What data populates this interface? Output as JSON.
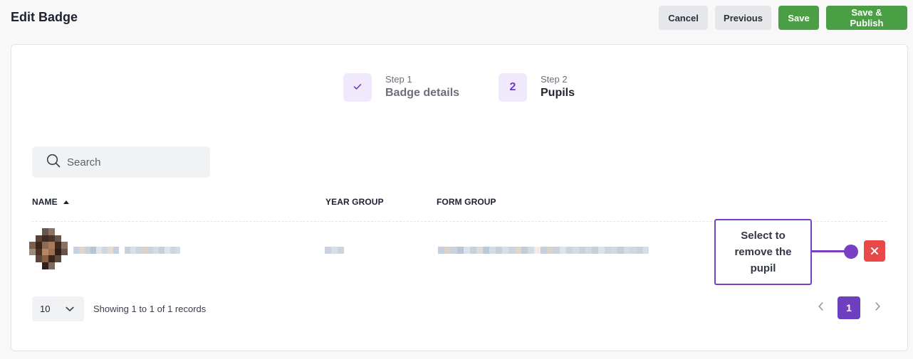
{
  "header": {
    "title": "Edit Badge",
    "cancel_label": "Cancel",
    "previous_label": "Previous",
    "save_label": "Save",
    "publish_label": "Save & Publish"
  },
  "stepper": {
    "steps": [
      {
        "number": "Step 1",
        "title": "Badge details",
        "status": "completed",
        "icon": "check-icon"
      },
      {
        "number": "Step 2",
        "title": "Pupils",
        "status": "current",
        "badge": "2"
      }
    ]
  },
  "search": {
    "placeholder": "Search",
    "value": ""
  },
  "table": {
    "columns": [
      {
        "label": "NAME",
        "sort": "ascending"
      },
      {
        "label": "YEAR GROUP"
      },
      {
        "label": "FORM GROUP"
      }
    ],
    "rows": [
      {
        "name": "[redacted]",
        "year_group": "[redacted]",
        "form_group": "[redacted]",
        "action": "remove"
      }
    ]
  },
  "tooltip": {
    "text": "Select to remove the pupil"
  },
  "footer": {
    "page_size": "10",
    "records_text": "Showing 1 to 1 of 1 records",
    "current_page": "1"
  },
  "colors": {
    "accent_purple": "#6e3fbf",
    "save_green": "#4a9e43",
    "remove_red": "#e84848",
    "step_bg": "#efe9fb"
  }
}
